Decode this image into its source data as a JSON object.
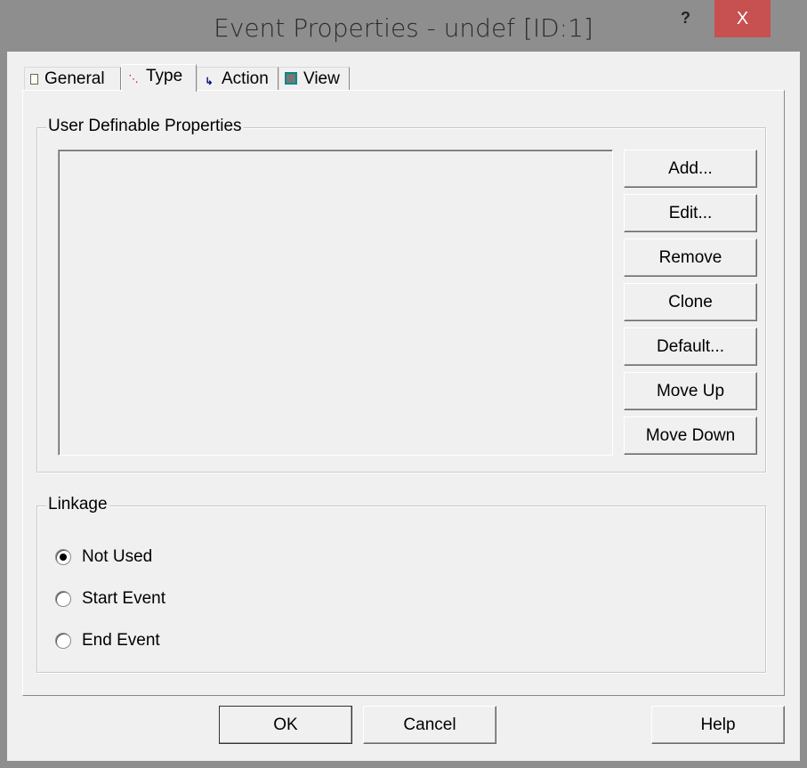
{
  "window": {
    "title": "Event Properties - undef [ID:1]",
    "help_glyph": "?",
    "close_glyph": "X"
  },
  "tabs": [
    {
      "label": "General",
      "icon": "notepad-icon"
    },
    {
      "label": "Type",
      "icon": "dotted-line-icon"
    },
    {
      "label": "Action",
      "icon": "action-icon"
    },
    {
      "label": "View",
      "icon": "monitor-icon"
    }
  ],
  "active_tab": "Type",
  "properties": {
    "group_label": "User Definable Properties",
    "buttons": [
      "Add...",
      "Edit...",
      "Remove",
      "Clone",
      "Default...",
      "Move Up",
      "Move Down"
    ]
  },
  "linkage": {
    "group_label": "Linkage",
    "options": [
      "Not Used",
      "Start Event",
      "End Event"
    ],
    "selected": "Not Used"
  },
  "footer": {
    "ok": "OK",
    "cancel": "Cancel",
    "help": "Help"
  }
}
